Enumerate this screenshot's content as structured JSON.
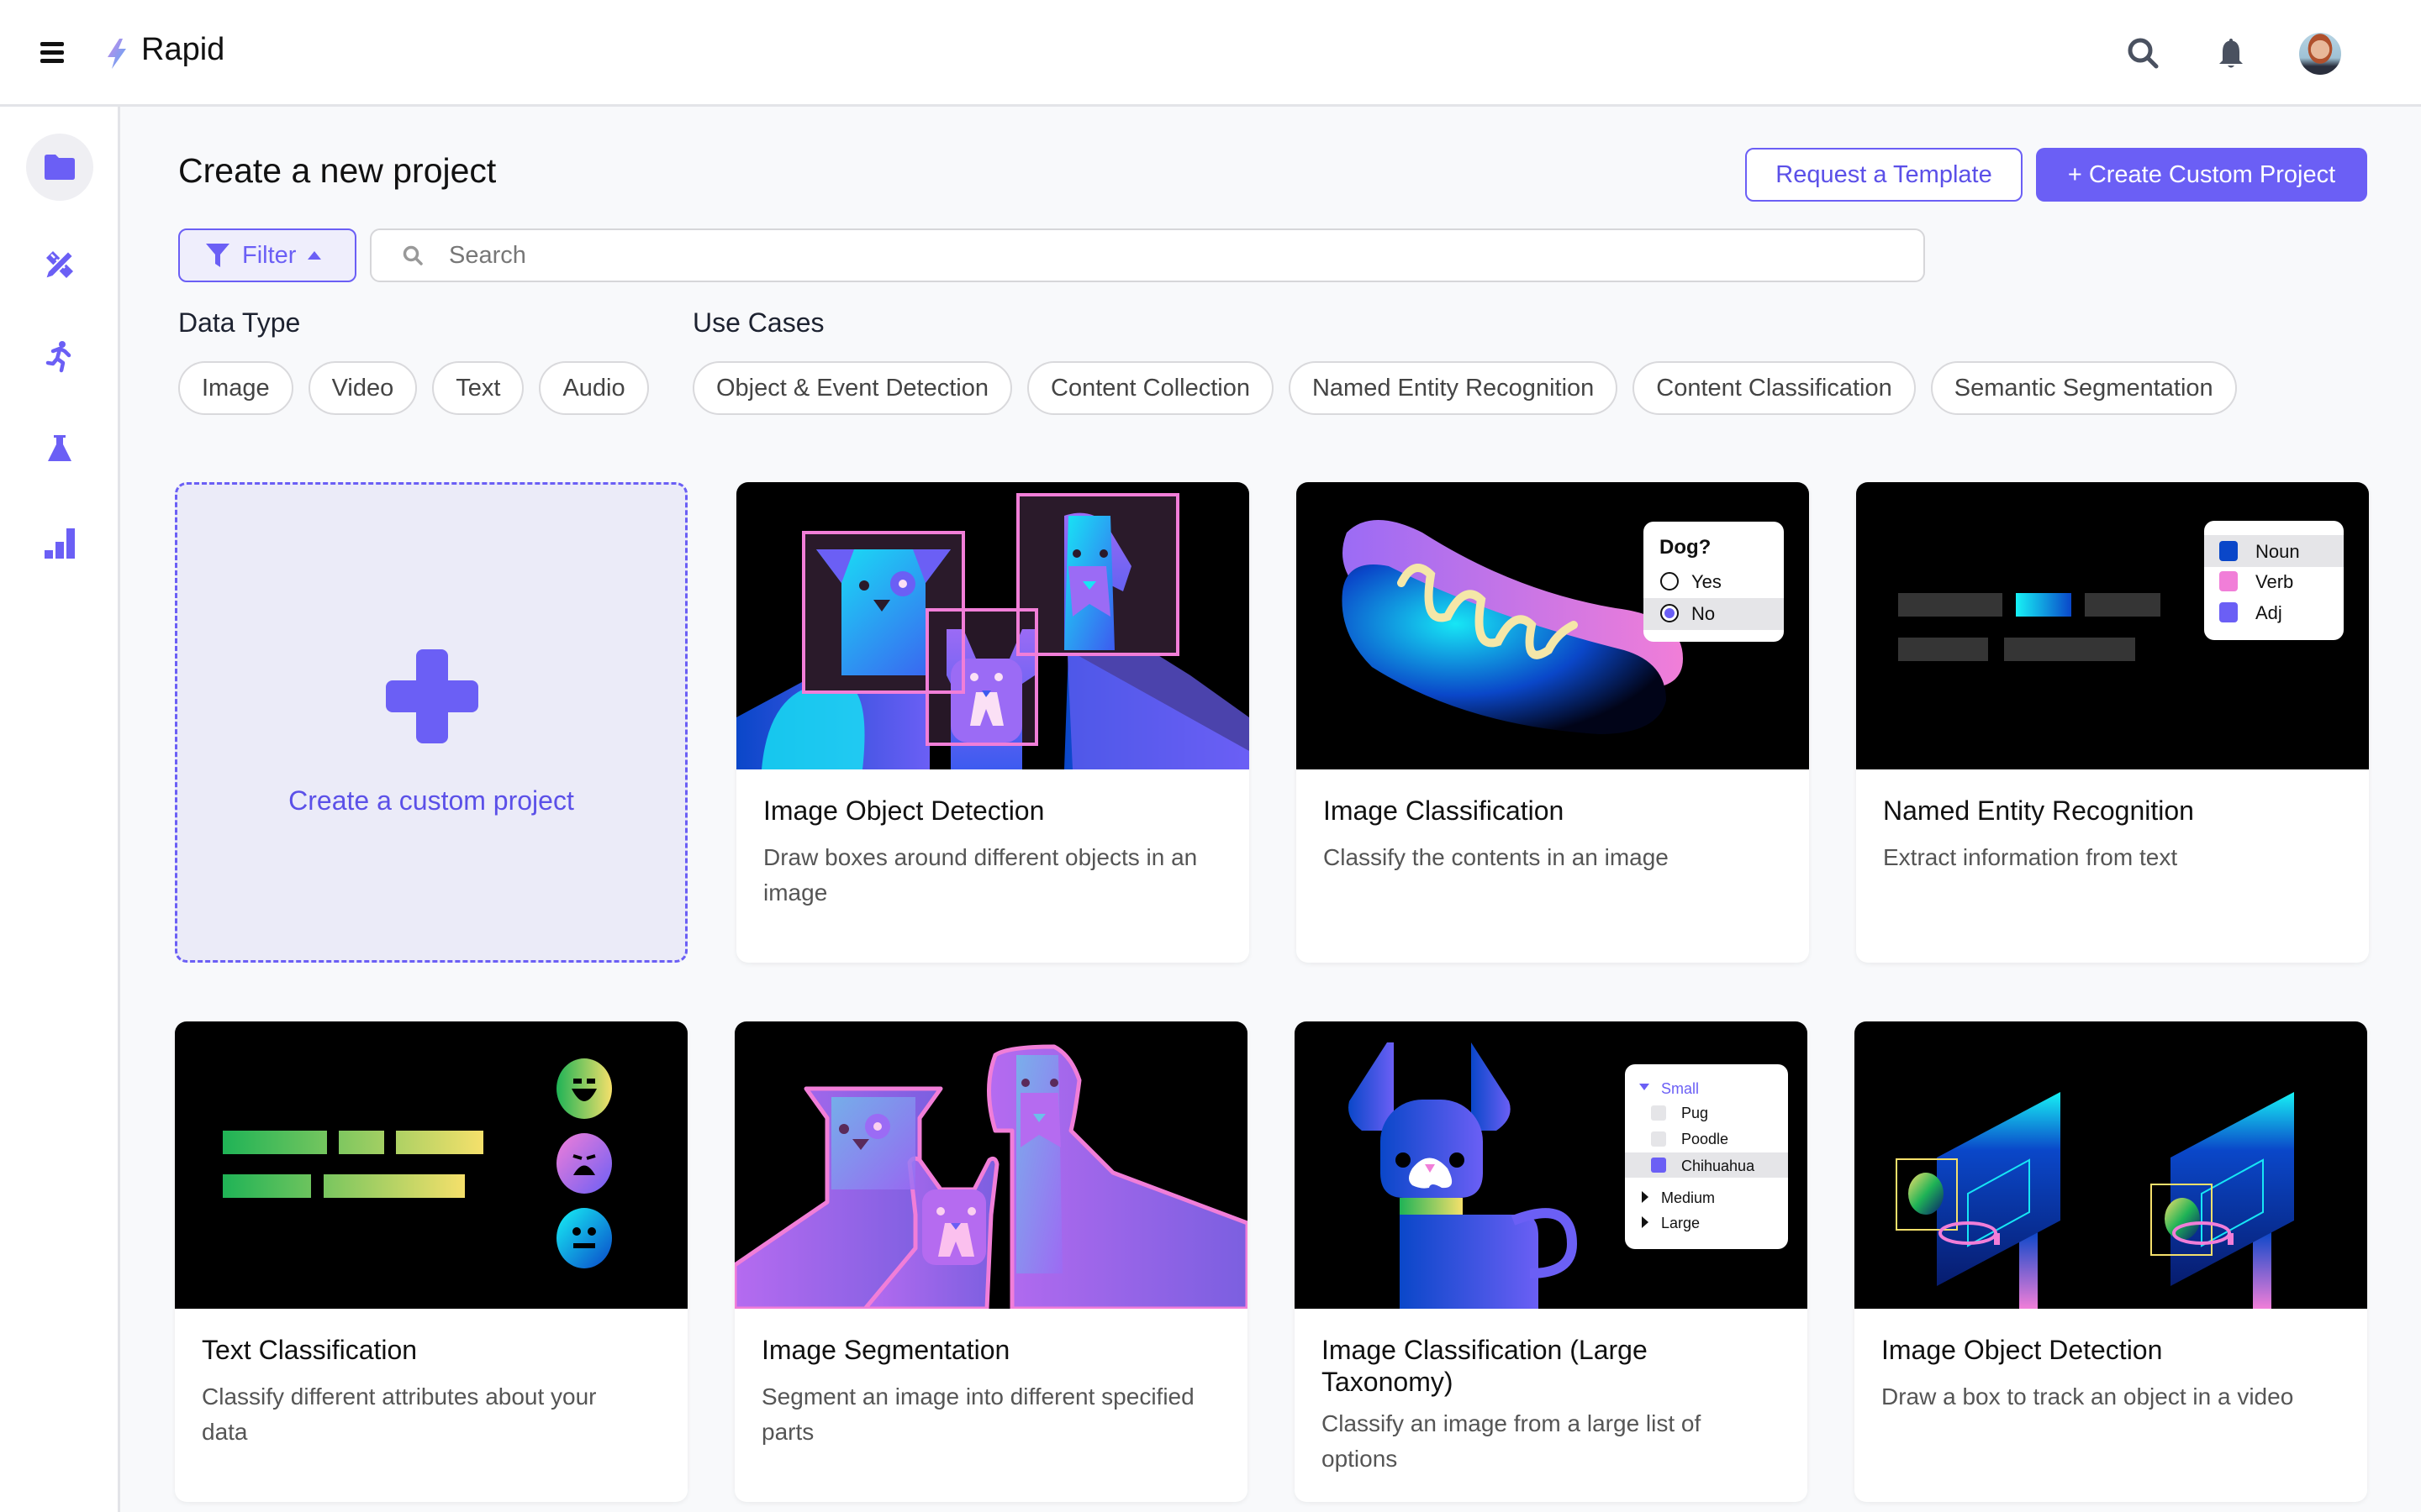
{
  "app": {
    "title": "Rapid"
  },
  "header": {
    "icons": [
      "menu-icon",
      "lightning-logo-icon",
      "search-icon",
      "bell-icon",
      "avatar"
    ]
  },
  "sidebar": {
    "items": [
      {
        "name": "projects",
        "icon": "folder-icon",
        "active": true
      },
      {
        "name": "design-tools",
        "icon": "pencil-ruler-icon",
        "active": false
      },
      {
        "name": "activity",
        "icon": "running-person-icon",
        "active": false
      },
      {
        "name": "experiments",
        "icon": "flask-icon",
        "active": false
      },
      {
        "name": "analytics",
        "icon": "bar-chart-icon",
        "active": false
      }
    ]
  },
  "main": {
    "title": "Create a new project",
    "request_template_label": "Request a Template",
    "create_custom_label": "+ Create Custom Project",
    "filter_label": "Filter",
    "search": {
      "placeholder": "Search",
      "value": ""
    },
    "data_type": {
      "label": "Data Type",
      "chips": [
        "Image",
        "Video",
        "Text",
        "Audio"
      ]
    },
    "use_cases": {
      "label": "Use Cases",
      "chips": [
        "Object & Event Detection",
        "Content Collection",
        "Named Entity Recognition",
        "Content Classification",
        "Semantic Segmentation"
      ]
    },
    "custom_card_label": "Create a custom project",
    "cards": [
      {
        "title": "Image Object Detection",
        "description": "Draw boxes around different objects in an image"
      },
      {
        "title": "Image Classification",
        "description": "Classify the contents in an image",
        "overlay": {
          "question": "Dog?",
          "options": [
            "Yes",
            "No"
          ],
          "selected": "No"
        }
      },
      {
        "title": "Named Entity Recognition",
        "description": "Extract information from text",
        "overlay": {
          "labels": [
            "Noun",
            "Verb",
            "Adj"
          ],
          "label_colors": [
            "#0a47c9",
            "#f17ed8",
            "#6b5ff5"
          ]
        }
      },
      {
        "title": "Text Classification",
        "description": "Classify different attributes about your data"
      },
      {
        "title": "Image Segmentation",
        "description": "Segment an image into different specified parts"
      },
      {
        "title": "Image Classification (Large Taxonomy)",
        "description": "Classify an image from a large list of options",
        "overlay": {
          "group_open": "Small",
          "items": [
            "Pug",
            "Poodle",
            "Chihuahua"
          ],
          "selected": "Chihuahua",
          "groups_closed": [
            "Medium",
            "Large"
          ]
        }
      },
      {
        "title": "Image Object Detection",
        "description": "Draw a box to track an object in a video"
      }
    ]
  },
  "colors": {
    "accent": "#6b5ff5",
    "accent_light": "#ebebf8",
    "pink": "#f17ed8",
    "cyan": "#17e6f5",
    "blue": "#0a47c9"
  }
}
